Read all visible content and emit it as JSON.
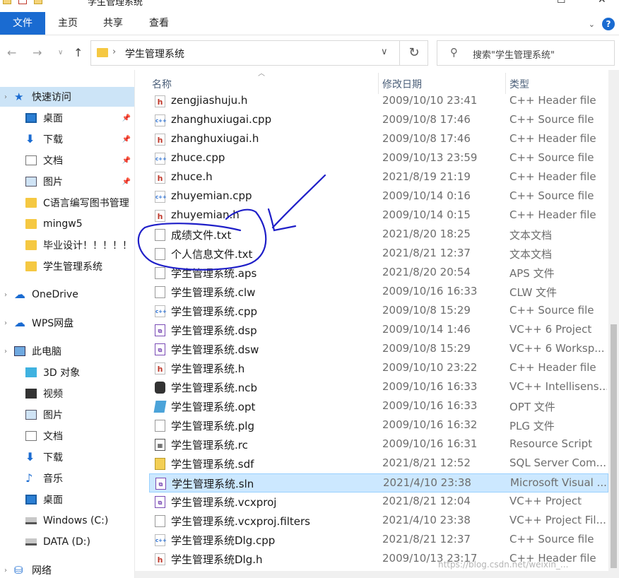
{
  "window": {
    "title": "学生管理系统"
  },
  "ribbon": {
    "tabs": [
      "文件",
      "主页",
      "共享",
      "查看"
    ],
    "help": "?"
  },
  "address": {
    "path": "学生管理系统",
    "search_placeholder": "搜索\"学生管理系统\""
  },
  "sidebar": {
    "items": [
      {
        "label": "快速访问",
        "icon": "star-icon"
      },
      {
        "label": "桌面",
        "icon": "desktop-icon"
      },
      {
        "label": "下载",
        "icon": "download-icon"
      },
      {
        "label": "文档",
        "icon": "document-icon"
      },
      {
        "label": "图片",
        "icon": "pictures-icon"
      },
      {
        "label": "C语言编写图书管理",
        "icon": "folder-icon"
      },
      {
        "label": "mingw5",
        "icon": "folder-icon"
      },
      {
        "label": "毕业设计！！！！！",
        "icon": "folder-icon"
      },
      {
        "label": "学生管理系统",
        "icon": "folder-icon"
      },
      {
        "label": "OneDrive",
        "icon": "cloud-icon"
      },
      {
        "label": "WPS网盘",
        "icon": "cloud-icon"
      },
      {
        "label": "此电脑",
        "icon": "computer-icon"
      },
      {
        "label": "3D 对象",
        "icon": "cube-icon"
      },
      {
        "label": "视频",
        "icon": "video-icon"
      },
      {
        "label": "图片",
        "icon": "pictures-icon"
      },
      {
        "label": "文档",
        "icon": "document-icon"
      },
      {
        "label": "下载",
        "icon": "download-icon"
      },
      {
        "label": "音乐",
        "icon": "music-icon"
      },
      {
        "label": "桌面",
        "icon": "desktop-icon"
      },
      {
        "label": "Windows (C:)",
        "icon": "drive-icon"
      },
      {
        "label": "DATA (D:)",
        "icon": "drive-icon"
      },
      {
        "label": "网络",
        "icon": "network-icon"
      }
    ]
  },
  "columns": {
    "name": "名称",
    "date": "修改日期",
    "type": "类型"
  },
  "files": [
    {
      "name": "zengjiashuju.h",
      "date": "2009/10/10 23:41",
      "type": "C++ Header file",
      "icon": "h"
    },
    {
      "name": "zhanghuxiugai.cpp",
      "date": "2009/10/8 17:46",
      "type": "C++ Source file",
      "icon": "cpp"
    },
    {
      "name": "zhanghuxiugai.h",
      "date": "2009/10/8 17:46",
      "type": "C++ Header file",
      "icon": "h"
    },
    {
      "name": "zhuce.cpp",
      "date": "2009/10/13 23:59",
      "type": "C++ Source file",
      "icon": "cpp"
    },
    {
      "name": "zhuce.h",
      "date": "2021/8/19 21:19",
      "type": "C++ Header file",
      "icon": "h"
    },
    {
      "name": "zhuyemian.cpp",
      "date": "2009/10/14 0:16",
      "type": "C++ Source file",
      "icon": "cpp"
    },
    {
      "name": "zhuyemian.h",
      "date": "2009/10/14 0:15",
      "type": "C++ Header file",
      "icon": "h"
    },
    {
      "name": "成绩文件.txt",
      "date": "2021/8/20 18:25",
      "type": "文本文档",
      "icon": "txt"
    },
    {
      "name": "个人信息文件.txt",
      "date": "2021/8/21 12:37",
      "type": "文本文档",
      "icon": "txt"
    },
    {
      "name": "学生管理系统.aps",
      "date": "2021/8/20 20:54",
      "type": "APS 文件",
      "icon": "gen"
    },
    {
      "name": "学生管理系统.clw",
      "date": "2009/10/16 16:33",
      "type": "CLW 文件",
      "icon": "gen"
    },
    {
      "name": "学生管理系统.cpp",
      "date": "2009/10/8 15:29",
      "type": "C++ Source file",
      "icon": "cpp"
    },
    {
      "name": "学生管理系统.dsp",
      "date": "2009/10/14 1:46",
      "type": "VC++ 6 Project",
      "icon": "proj"
    },
    {
      "name": "学生管理系统.dsw",
      "date": "2009/10/8 15:29",
      "type": "VC++ 6 Worksp...",
      "icon": "proj"
    },
    {
      "name": "学生管理系统.h",
      "date": "2009/10/10 23:22",
      "type": "C++ Header file",
      "icon": "h"
    },
    {
      "name": "学生管理系统.ncb",
      "date": "2009/10/16 16:33",
      "type": "VC++ Intellisens...",
      "icon": "db"
    },
    {
      "name": "学生管理系统.opt",
      "date": "2009/10/16 16:33",
      "type": "OPT 文件",
      "icon": "opt"
    },
    {
      "name": "学生管理系统.plg",
      "date": "2009/10/16 16:32",
      "type": "PLG 文件",
      "icon": "gen"
    },
    {
      "name": "学生管理系统.rc",
      "date": "2009/10/16 16:31",
      "type": "Resource Script",
      "icon": "rc"
    },
    {
      "name": "学生管理系统.sdf",
      "date": "2021/8/21 12:52",
      "type": "SQL Server Com...",
      "icon": "sdf"
    },
    {
      "name": "学生管理系统.sln",
      "date": "2021/4/10 23:38",
      "type": "Microsoft Visual ...",
      "icon": "proj",
      "selected": true
    },
    {
      "name": "学生管理系统.vcxproj",
      "date": "2021/8/21 12:04",
      "type": "VC++ Project",
      "icon": "proj"
    },
    {
      "name": "学生管理系统.vcxproj.filters",
      "date": "2021/4/10 23:38",
      "type": "VC++ Project Fil...",
      "icon": "gen"
    },
    {
      "name": "学生管理系统Dlg.cpp",
      "date": "2021/8/21 12:37",
      "type": "C++ Source file",
      "icon": "cpp"
    },
    {
      "name": "学生管理系统Dlg.h",
      "date": "2009/10/13 23:17",
      "type": "C++ Header file",
      "icon": "h"
    }
  ],
  "watermark": "https://blog.csdn.net/weixin_...",
  "colors": {
    "accent": "#1a6bd1",
    "selection": "#cce8ff",
    "ink": "#1f1fc8"
  }
}
